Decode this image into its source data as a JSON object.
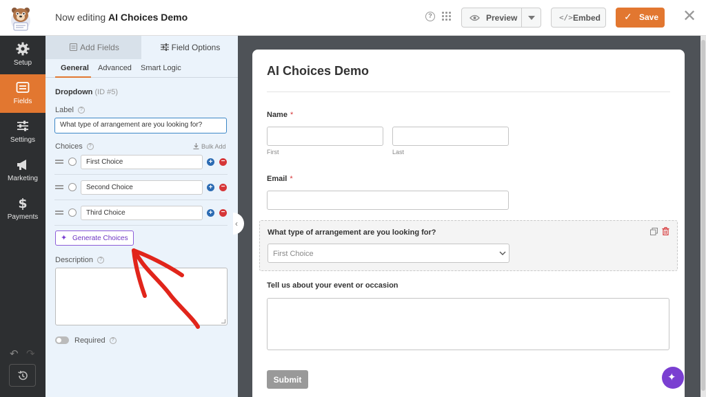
{
  "header": {
    "title_prefix": "Now editing",
    "form_name": "AI Choices Demo",
    "help": "?",
    "preview": "Preview",
    "embed_code": "</>",
    "embed": "Embed",
    "save": "Save",
    "save_check": "✓",
    "close": "✕"
  },
  "sidebar": {
    "items": [
      {
        "label": "Setup",
        "icon": "gear-icon"
      },
      {
        "label": "Fields",
        "icon": "list-icon"
      },
      {
        "label": "Settings",
        "icon": "sliders-icon"
      },
      {
        "label": "Marketing",
        "icon": "megaphone-icon"
      },
      {
        "label": "Payments",
        "icon": "dollar-icon"
      }
    ],
    "undo": "↶",
    "redo": "↷"
  },
  "panel": {
    "tabs": [
      "Add Fields",
      "Field Options"
    ],
    "subtabs": [
      "General",
      "Advanced",
      "Smart Logic"
    ],
    "field_type": "Dropdown",
    "field_id": "(ID #5)",
    "label_heading": "Label",
    "label_value": "What type of arrangement are you looking for?",
    "choices_heading": "Choices",
    "bulk_add": "Bulk Add",
    "choices": [
      "First Choice",
      "Second Choice",
      "Third Choice"
    ],
    "add": "+",
    "remove": "−",
    "generate": "Generate Choices",
    "description_heading": "Description",
    "required_label": "Required"
  },
  "form": {
    "title": "AI Choices Demo",
    "name_label": "Name",
    "req_mark": "*",
    "first_sub": "First",
    "last_sub": "Last",
    "email_label": "Email",
    "dropdown_label": "What type of arrangement are you looking for?",
    "dropdown_placeholder": "First Choice",
    "event_label": "Tell us about your event or occasion",
    "submit": "Submit"
  },
  "colors": {
    "accent": "#e27730",
    "sidebar_bg": "#2d2f31",
    "panel_bg": "#ebf3fb",
    "ai_purple": "#7a3fd1"
  }
}
